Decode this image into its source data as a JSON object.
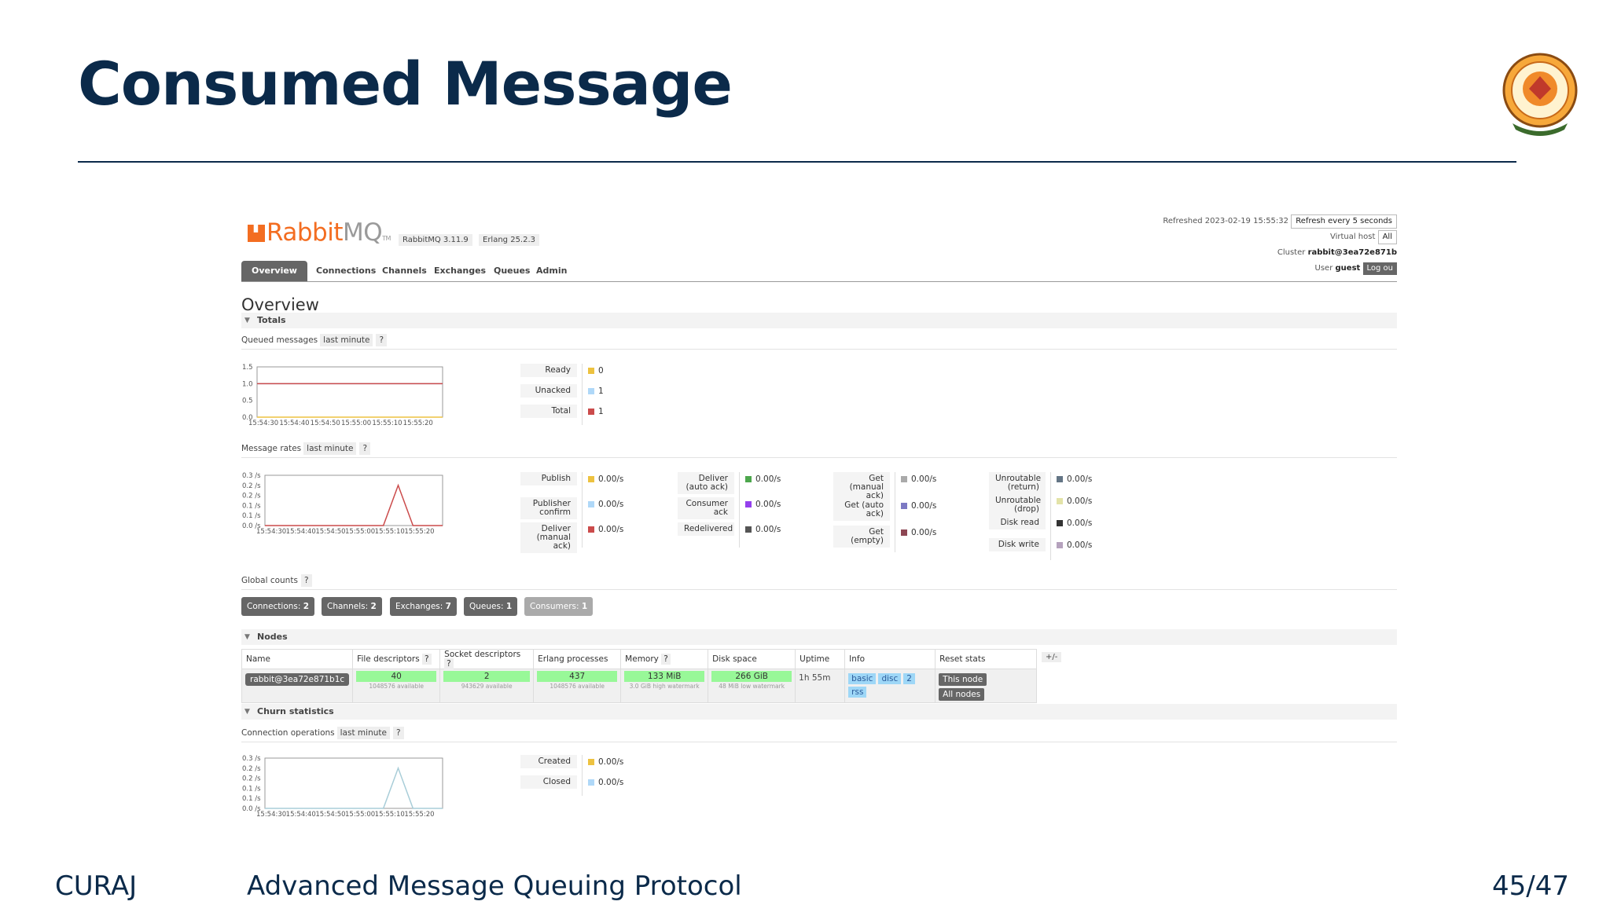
{
  "slide": {
    "title": "Consumed Message",
    "footer_left": "CURAJ",
    "footer_center": "Advanced Message Queuing Protocol",
    "footer_right": "45/47"
  },
  "colors": {
    "title": "#0b2a4a",
    "brand": "#f36d21",
    "tab_active": "#666666",
    "good": "#98f898",
    "info": "#9ed7f7"
  },
  "icons": {
    "logo": "university-seal-icon",
    "collapse": "triangle-down-icon"
  },
  "header": {
    "brand_rabbit": "Rabbit",
    "brand_mq": "MQ",
    "brand_tm": "TM",
    "version": "RabbitMQ 3.11.9",
    "erlang": "Erlang 25.2.3",
    "refreshed_label": "Refreshed 2023-02-19 15:55:32",
    "refresh_select": "Refresh every 5 seconds",
    "vhost_label": "Virtual host",
    "vhost_value": "All",
    "cluster_label": "Cluster",
    "cluster_value": "rabbit@3ea72e871b",
    "user_label": "User",
    "user_value": "guest",
    "logout": "Log ou"
  },
  "tabs": [
    "Overview",
    "Connections",
    "Channels",
    "Exchanges",
    "Queues",
    "Admin"
  ],
  "overview": {
    "heading": "Overview",
    "totals_section": "Totals",
    "queued_label": "Queued messages",
    "queued_range": "last minute",
    "help": "?",
    "rates_label": "Message rates",
    "rates_range": "last minute",
    "global_label": "Global counts",
    "nodes_section": "Nodes",
    "churn_section": "Churn statistics",
    "conn_ops_label": "Connection operations",
    "conn_ops_range": "last minute",
    "plus_minus": "+/-"
  },
  "queued_legend": [
    {
      "label": "Ready",
      "value": "0",
      "color": "#edc240"
    },
    {
      "label": "Unacked",
      "value": "1",
      "color": "#afd8f8"
    },
    {
      "label": "Total",
      "value": "1",
      "color": "#cb4b4b"
    }
  ],
  "rates_legend": {
    "col1": [
      {
        "label": "Publish",
        "value": "0.00/s",
        "color": "#edc240"
      },
      {
        "label": "Publisher confirm",
        "value": "0.00/s",
        "color": "#afd8f8"
      },
      {
        "label": "Deliver (manual ack)",
        "value": "0.00/s",
        "color": "#cb4b4b"
      }
    ],
    "col2": [
      {
        "label": "Deliver (auto ack)",
        "value": "0.00/s",
        "color": "#4da74d"
      },
      {
        "label": "Consumer ack",
        "value": "0.00/s",
        "color": "#9440ed"
      },
      {
        "label": "Redelivered",
        "value": "0.00/s",
        "color": "#555555"
      }
    ],
    "col3": [
      {
        "label": "Get (manual ack)",
        "value": "0.00/s",
        "color": "#aaaaaa"
      },
      {
        "label": "Get (auto ack)",
        "value": "0.00/s",
        "color": "#7c79c3"
      },
      {
        "label": "Get (empty)",
        "value": "0.00/s",
        "color": "#8d4653"
      }
    ],
    "col4": [
      {
        "label": "Unroutable (return)",
        "value": "0.00/s",
        "color": "#647585"
      },
      {
        "label": "Unroutable (drop)",
        "value": "0.00/s",
        "color": "#e3e3a8"
      },
      {
        "label": "Disk read",
        "value": "0.00/s",
        "color": "#333333"
      },
      {
        "label": "Disk write",
        "value": "0.00/s",
        "color": "#b5a2bd"
      }
    ]
  },
  "global_counts": [
    {
      "label": "Connections:",
      "value": "2"
    },
    {
      "label": "Channels:",
      "value": "2"
    },
    {
      "label": "Exchanges:",
      "value": "7"
    },
    {
      "label": "Queues:",
      "value": "1"
    },
    {
      "label": "Consumers:",
      "value": "1"
    }
  ],
  "nodes": {
    "headers": [
      "Name",
      "File descriptors",
      "Socket descriptors",
      "Erlang processes",
      "Memory",
      "Disk space",
      "Uptime",
      "Info",
      "Reset stats"
    ],
    "row": {
      "name": "rabbit@3ea72e871b1c",
      "fd": "40",
      "fd_sub": "1048576 available",
      "sd": "2",
      "sd_sub": "943629 available",
      "ep": "437",
      "ep_sub": "1048576 available",
      "mem": "133 MiB",
      "mem_sub": "3.0 GiB high watermark",
      "disk": "266 GiB",
      "disk_sub": "48 MiB low watermark",
      "uptime": "1h 55m",
      "info": [
        "basic",
        "disc",
        "2",
        "rss"
      ],
      "reset": [
        "This node",
        "All nodes"
      ]
    }
  },
  "churn_legend": [
    {
      "label": "Created",
      "value": "0.00/s",
      "color": "#edc240"
    },
    {
      "label": "Closed",
      "value": "0.00/s",
      "color": "#afd8f8"
    }
  ],
  "chart_data": [
    {
      "type": "line",
      "x": [
        "15:54:30",
        "15:54:40",
        "15:54:50",
        "15:55:00",
        "15:55:10",
        "15:55:20"
      ],
      "series": [
        {
          "name": "Ready",
          "color": "#edc240",
          "x": [
            0,
            60
          ],
          "y": [
            0,
            0
          ]
        },
        {
          "name": "Unacked",
          "color": "#afd8f8",
          "x": [
            0,
            60
          ],
          "y": [
            1,
            1
          ]
        },
        {
          "name": "Total",
          "color": "#cb4b4b",
          "x": [
            0,
            60
          ],
          "y": [
            1,
            1
          ]
        }
      ],
      "yticks": [
        "1.5",
        "1.0",
        "0.5",
        "0.0"
      ],
      "ylim": [
        0,
        1.5
      ],
      "xlim": [
        0,
        60
      ]
    },
    {
      "type": "line",
      "x": [
        "15:54:30",
        "15:54:40",
        "15:54:50",
        "15:55:00",
        "15:55:10",
        "15:55:20"
      ],
      "series": [
        {
          "name": "Deliver (manual ack)",
          "color": "#cb4b4b",
          "x": [
            0,
            40,
            45,
            50,
            60
          ],
          "y": [
            0,
            0,
            0.2,
            0,
            0
          ]
        }
      ],
      "yticks": [
        "0.3 /s",
        "0.2 /s",
        "0.2 /s",
        "0.1 /s",
        "0.1 /s",
        "0.0 /s"
      ],
      "ylim": [
        0,
        0.25
      ],
      "xlim": [
        0,
        60
      ]
    },
    {
      "type": "line",
      "x": [
        "15:54:30",
        "15:54:40",
        "15:54:50",
        "15:55:00",
        "15:55:10",
        "15:55:20"
      ],
      "series": [
        {
          "name": "Closed",
          "color": "#a8cdd8",
          "x": [
            0,
            40,
            45,
            50,
            60
          ],
          "y": [
            0,
            0,
            0.2,
            0,
            0
          ]
        }
      ],
      "yticks": [
        "0.3 /s",
        "0.2 /s",
        "0.2 /s",
        "0.1 /s",
        "0.1 /s",
        "0.0 /s"
      ],
      "ylim": [
        0,
        0.25
      ],
      "xlim": [
        0,
        60
      ]
    }
  ]
}
